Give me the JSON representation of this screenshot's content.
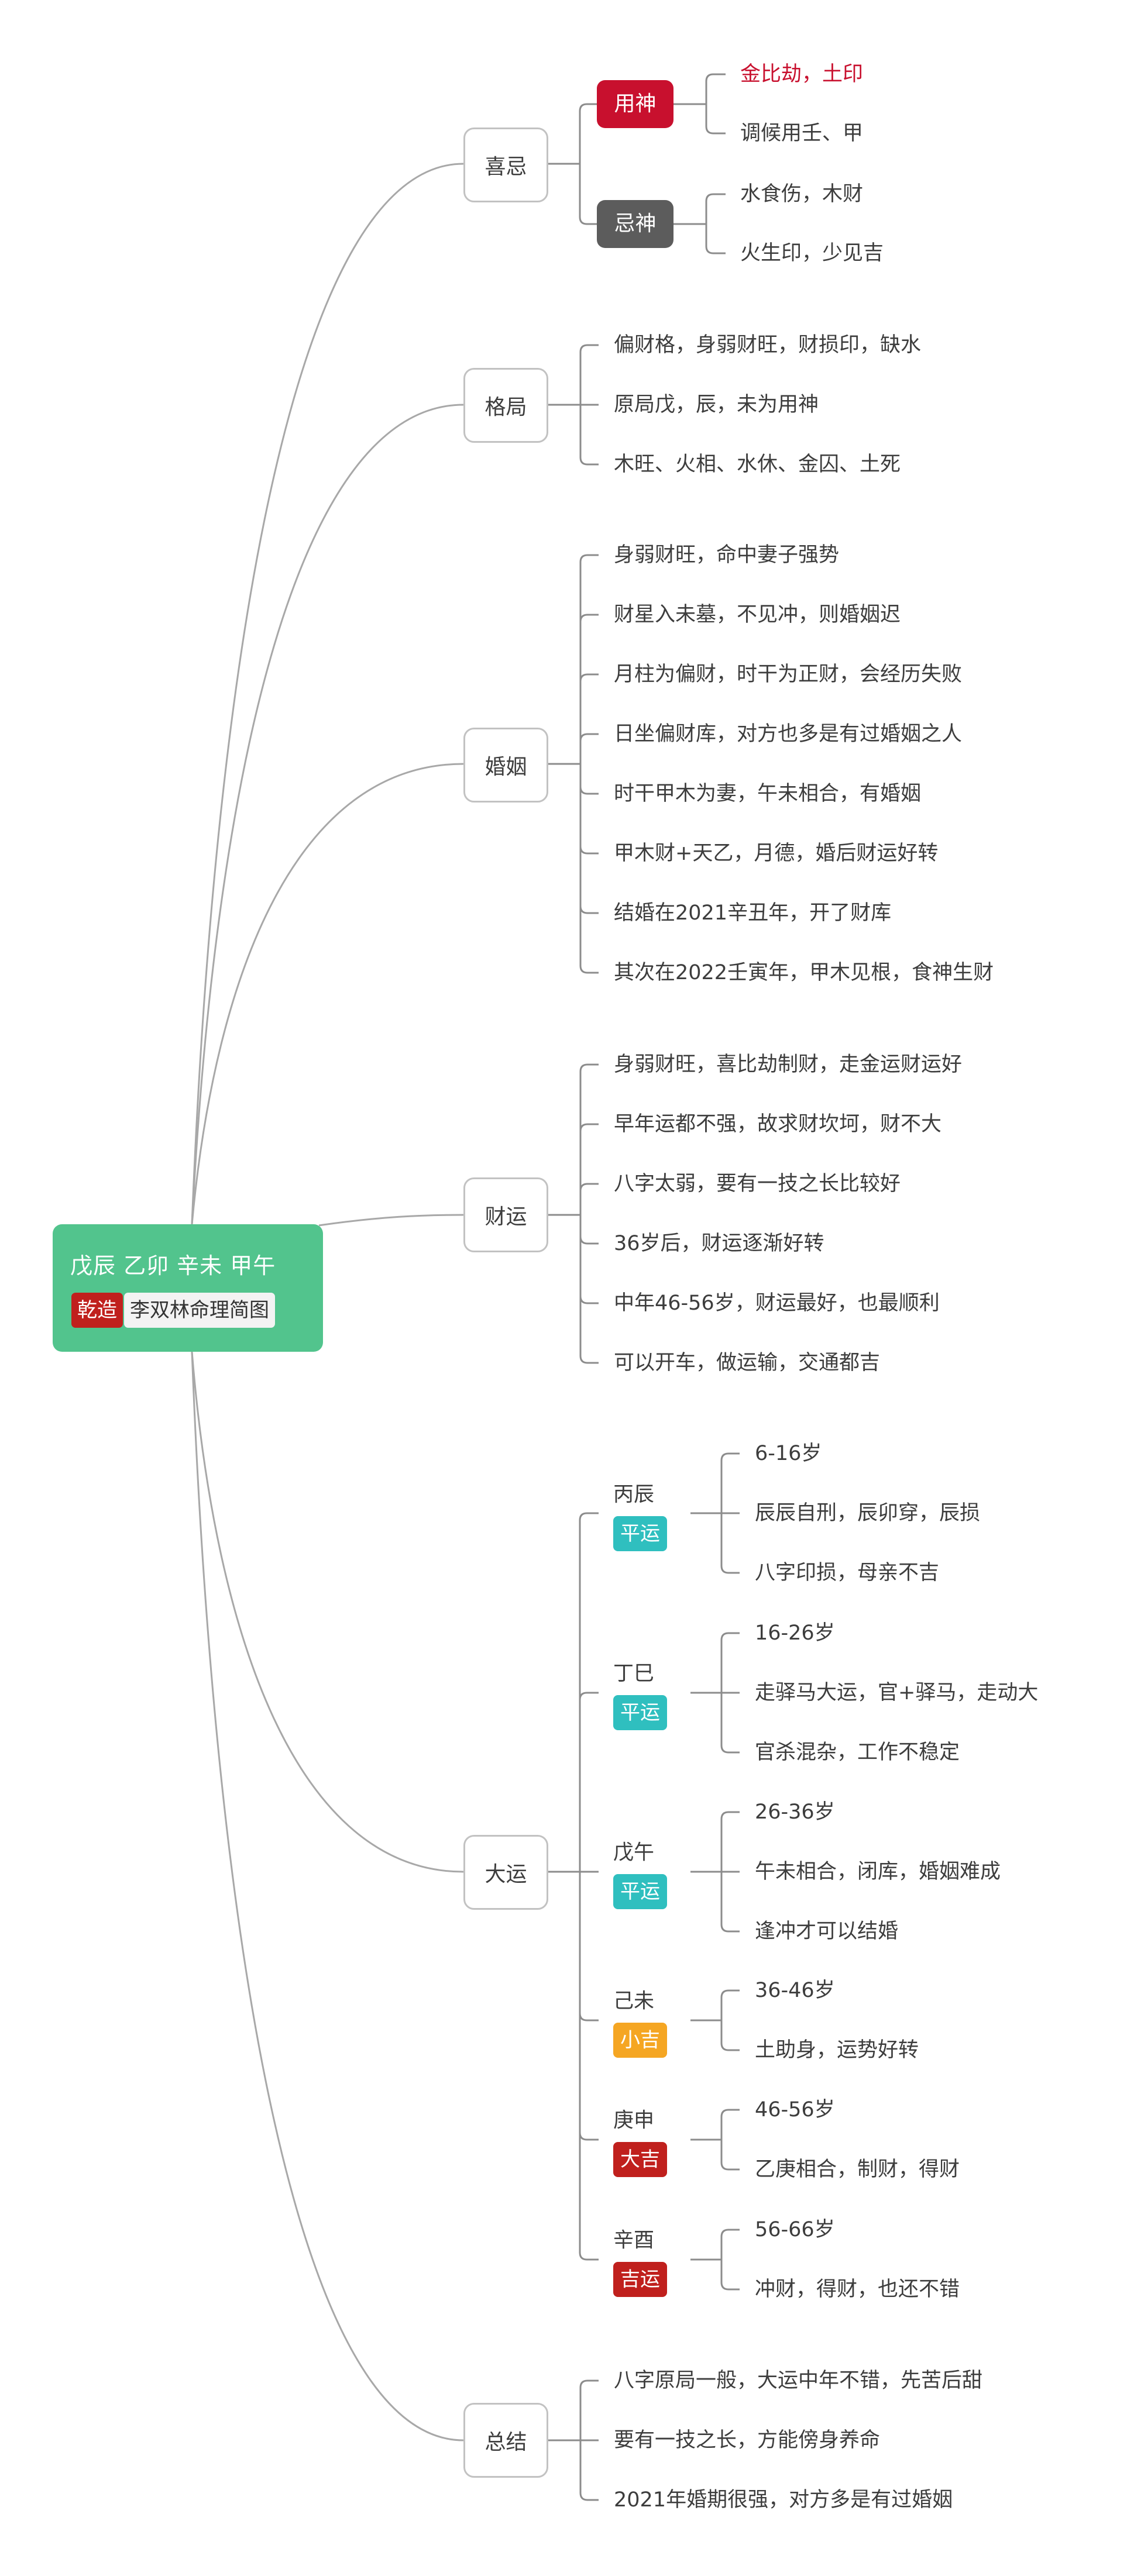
{
  "root": {
    "title": "戊辰 乙卯 辛未 甲午",
    "gender_tag": "乾造",
    "name_tag": "李双林命理简图",
    "color": "#52c48d"
  },
  "colors": {
    "line": "#a8a8a8",
    "bracket": "#8c8c8c",
    "useful_god": "#c8102e",
    "taboo_god": "#5c5c5c",
    "ping_yun": "#2fbfbf",
    "xiao_ji": "#f5a623",
    "da_ji": "#c0201d"
  },
  "branches": {
    "xiji": {
      "label": "喜忌",
      "groups": [
        {
          "label": "用神",
          "color": "#c8102e",
          "items": [
            {
              "text": "金比劫，土印",
              "highlight": true
            },
            {
              "text": "调候用壬、甲",
              "highlight": false
            }
          ]
        },
        {
          "label": "忌神",
          "color": "#5c5c5c",
          "items": [
            {
              "text": "水食伤，木财",
              "highlight": false
            },
            {
              "text": "火生印，少见吉",
              "highlight": false
            }
          ]
        }
      ]
    },
    "geju": {
      "label": "格局",
      "items": [
        "偏财格，身弱财旺，财损印，缺水",
        "原局戊，辰，未为用神",
        "木旺、火相、水休、金囚、土死"
      ]
    },
    "hunyin": {
      "label": "婚姻",
      "items": [
        "身弱财旺，命中妻子强势",
        "财星入未墓，不见冲，则婚姻迟",
        "月柱为偏财，时干为正财，会经历失败",
        "日坐偏财库，对方也多是有过婚姻之人",
        "时干甲木为妻，午未相合，有婚姻",
        "甲木财+天乙，月德，婚后财运好转",
        "结婚在2021辛丑年，开了财库",
        "其次在2022壬寅年，甲木见根，食神生财"
      ]
    },
    "caiyun": {
      "label": "财运",
      "items": [
        "身弱财旺，喜比劫制财，走金运财运好",
        "早年运都不强，故求财坎坷，财不大",
        "八字太弱，要有一技之长比较好",
        "36岁后，财运逐渐好转",
        "中年46-56岁，财运最好，也最顺利",
        "可以开车，做运输，交通都吉"
      ]
    },
    "dayun": {
      "label": "大运",
      "periods": [
        {
          "pillar": "丙辰",
          "rating": "平运",
          "color": "#2fbfbf",
          "items": [
            "6-16岁",
            "辰辰自刑，辰卯穿，辰损",
            "八字印损，母亲不吉"
          ]
        },
        {
          "pillar": "丁巳",
          "rating": "平运",
          "color": "#2fbfbf",
          "items": [
            "16-26岁",
            "走驿马大运，官+驿马，走动大",
            "官杀混杂，工作不稳定"
          ]
        },
        {
          "pillar": "戊午",
          "rating": "平运",
          "color": "#2fbfbf",
          "items": [
            "26-36岁",
            "午未相合，闭库，婚姻难成",
            "逢冲才可以结婚"
          ]
        },
        {
          "pillar": "己未",
          "rating": "小吉",
          "color": "#f5a623",
          "items": [
            "36-46岁",
            "土助身，运势好转"
          ]
        },
        {
          "pillar": "庚申",
          "rating": "大吉",
          "color": "#c0201d",
          "items": [
            "46-56岁",
            "乙庚相合，制财，得财"
          ]
        },
        {
          "pillar": "辛酉",
          "rating": "吉运",
          "color": "#c0201d",
          "items": [
            "56-66岁",
            "冲财，得财，也还不错"
          ]
        }
      ]
    },
    "zongjie": {
      "label": "总结",
      "items": [
        "八字原局一般，大运中年不错，先苦后甜",
        "要有一技之长，方能傍身养命",
        "2021年婚期很强，对方多是有过婚姻"
      ]
    }
  }
}
